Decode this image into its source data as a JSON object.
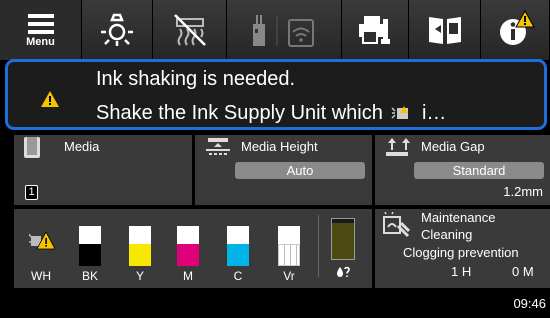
{
  "toolbar": {
    "menu_label": "Menu",
    "buttons": [
      "menu-icon",
      "light-icon",
      "heater-off-icon",
      "wifi-off-icon",
      "printer-settings-icon",
      "manual-book-icon",
      "info-alert-icon"
    ]
  },
  "alert": {
    "line1": "Ink shaking is needed.",
    "line2_prefix": "Shake the Ink Supply Unit which",
    "line2_suffix": "i…",
    "border_color": "#1e6fd9",
    "warning_color": "#f5c400"
  },
  "media": {
    "title": "Media",
    "badge": "1"
  },
  "media_height": {
    "title": "Media Height",
    "value": "Auto"
  },
  "media_gap": {
    "title": "Media Gap",
    "value": "Standard",
    "measure": "1.2mm"
  },
  "inks": [
    {
      "label": "WH",
      "color": "#ffffff",
      "level": 0.55,
      "warning": true
    },
    {
      "label": "BK",
      "color": "#000000",
      "level": 0.55
    },
    {
      "label": "Y",
      "color": "#f7e800",
      "level": 0.55
    },
    {
      "label": "M",
      "color": "#e0007a",
      "level": 0.55
    },
    {
      "label": "C",
      "color": "#00b4e8",
      "level": 0.55
    },
    {
      "label": "Vr",
      "color": "#ffffff",
      "level": 0.55
    }
  ],
  "waste": {
    "color": "#4b4a10",
    "level": 0.9,
    "icon": "waste-ink-icon"
  },
  "maintenance": {
    "line1": "Maintenance",
    "line2": "Cleaning",
    "line3": "Clogging prevention",
    "hours": "1 H",
    "minutes": "0 M"
  },
  "clock": "09:46"
}
